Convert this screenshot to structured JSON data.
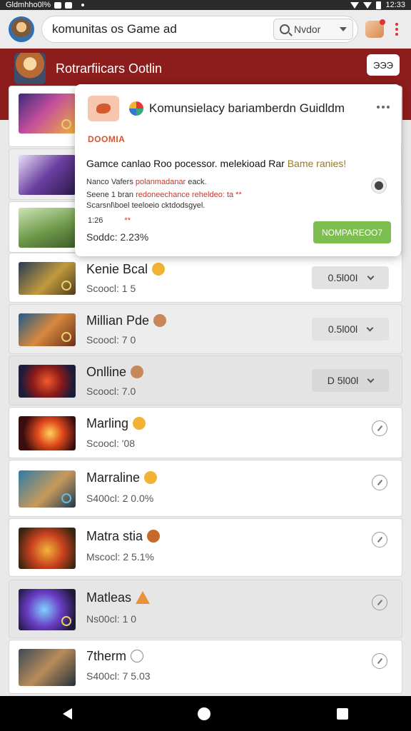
{
  "status_bar": {
    "carrier": "Gldmhho0l%",
    "time": "12:33"
  },
  "app_bar": {
    "search_query": "komunitas os Game ad",
    "mode_value": "Nvdor"
  },
  "header": {
    "title": "Rotrarfiicars Ootlin",
    "button_label": "ЭЭЭ"
  },
  "popup": {
    "title": "Komunsielacy bariamberdn Guidldm",
    "tag": "DOOMIA",
    "heading_main": "Gamce canlao Roo pocessor. melekioad  Rar",
    "heading_highlight": "Bame ranies!",
    "desc_line1_a": "Nanco Vafers",
    "desc_line1_b": "polanmadanar",
    "desc_line1_c": "eack.",
    "desc_line2_a": "Seene 1 bran",
    "desc_line2_b": "redoneechance reheldeo: ta **",
    "desc_line3": "Scarsnl\\boel teeloeio cktdodsgyel.",
    "num_left": "1:26",
    "num_right": "**",
    "score": "Soddc:  2.23%",
    "cta_label": "NOMPAREOO7"
  },
  "games": [
    {
      "name": "",
      "sub": "",
      "control": "none"
    },
    {
      "name": "",
      "sub": "",
      "control": "none"
    },
    {
      "name": "",
      "sub": "",
      "control": "none"
    },
    {
      "name": "Kenie Bcal",
      "sub": "Scoocl:  1 5",
      "control": "select",
      "control_value": "0.5l00I"
    },
    {
      "name": "Millian Pde",
      "sub": "Scoocl:  7 0",
      "control": "select",
      "control_value": "0.5l00l"
    },
    {
      "name": "Onlline",
      "sub": "Scoocl:  7.0",
      "control": "select",
      "control_value": "D 5l00l"
    },
    {
      "name": "Marling",
      "sub": "Scoocl:  '08",
      "control": "icon"
    },
    {
      "name": "Marraline",
      "sub": "S400cl:  2 0.0%",
      "control": "icon"
    },
    {
      "name": "Matra stia",
      "sub": "Mscocl:  2 5.1%",
      "control": "icon"
    },
    {
      "name": "Matleas",
      "sub": "Ns00cl:  1 0",
      "control": "icon"
    },
    {
      "name": "7therm",
      "sub": "S400cl:  7 5.03",
      "control": "icon"
    }
  ]
}
